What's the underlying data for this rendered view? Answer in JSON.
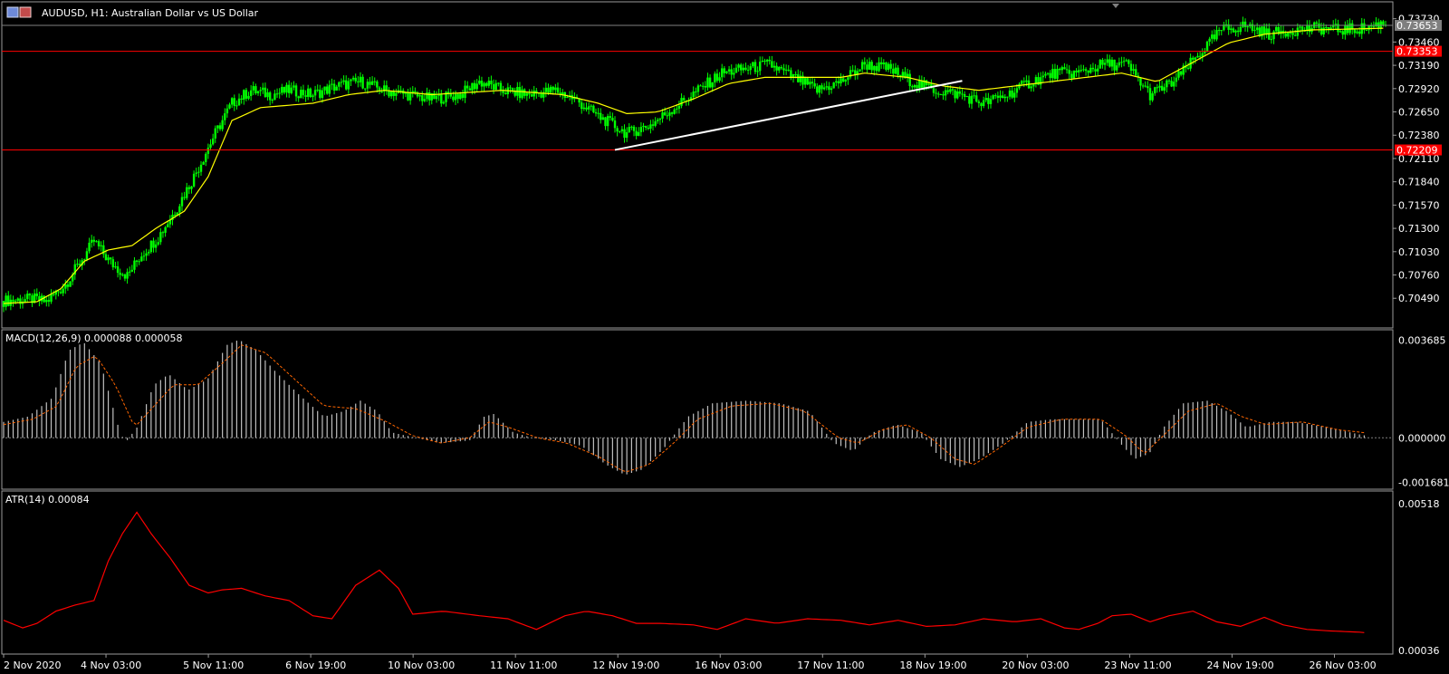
{
  "window": {
    "title": "AUDUSD, H1:  Australian Dollar vs US Dollar",
    "icon": "chart-window-icon"
  },
  "colors": {
    "background": "#000000",
    "candle": "#00ff00",
    "moving_average": "#ffff00",
    "hline": "#ff0000",
    "trendline": "#ffffff",
    "macd_hist": "#c0c0c0",
    "macd_signal": "#ff6600",
    "atr_line": "#ff0000",
    "pane_border": "#ffffff",
    "tag_bg": "#ff0000"
  },
  "chart_data": [
    {
      "type": "candlestick",
      "title": "AUDUSD, H1:  Australian Dollar vs US Dollar",
      "x_labels": [
        "2 Nov 2020",
        "4 Nov 03:00",
        "5 Nov 11:00",
        "6 Nov 19:00",
        "10 Nov 03:00",
        "11 Nov 11:00",
        "12 Nov 19:00",
        "16 Nov 03:00",
        "17 Nov 11:00",
        "18 Nov 19:00",
        "20 Nov 03:00",
        "23 Nov 11:00",
        "24 Nov 19:00",
        "26 Nov 03:00"
      ],
      "y_ticks": [
        "0.73730",
        "0.73460",
        "0.73190",
        "0.72920",
        "0.72650",
        "0.72380",
        "0.72110",
        "0.71840",
        "0.71570",
        "0.71300",
        "0.71030",
        "0.70760",
        "0.70490"
      ],
      "ylim": [
        0.7023,
        0.738
      ],
      "close_path": [
        [
          0,
          0.7046
        ],
        [
          12,
          0.7048
        ],
        [
          18,
          0.7045
        ],
        [
          26,
          0.7065
        ],
        [
          32,
          0.709
        ],
        [
          38,
          0.7115
        ],
        [
          45,
          0.709
        ],
        [
          52,
          0.7075
        ],
        [
          58,
          0.71
        ],
        [
          65,
          0.712
        ],
        [
          72,
          0.715
        ],
        [
          80,
          0.719
        ],
        [
          88,
          0.7235
        ],
        [
          96,
          0.7275
        ],
        [
          104,
          0.729
        ],
        [
          112,
          0.7285
        ],
        [
          120,
          0.729
        ],
        [
          130,
          0.7285
        ],
        [
          140,
          0.7295
        ],
        [
          150,
          0.73
        ],
        [
          160,
          0.729
        ],
        [
          170,
          0.7285
        ],
        [
          180,
          0.728
        ],
        [
          192,
          0.7285
        ],
        [
          200,
          0.73
        ],
        [
          210,
          0.729
        ],
        [
          220,
          0.7285
        ],
        [
          232,
          0.729
        ],
        [
          240,
          0.728
        ],
        [
          250,
          0.726
        ],
        [
          262,
          0.724
        ],
        [
          272,
          0.725
        ],
        [
          282,
          0.727
        ],
        [
          292,
          0.729
        ],
        [
          302,
          0.731
        ],
        [
          312,
          0.7315
        ],
        [
          322,
          0.732
        ],
        [
          332,
          0.7305
        ],
        [
          342,
          0.729
        ],
        [
          352,
          0.73
        ],
        [
          362,
          0.732
        ],
        [
          372,
          0.7315
        ],
        [
          382,
          0.73
        ],
        [
          392,
          0.729
        ],
        [
          402,
          0.7285
        ],
        [
          412,
          0.7275
        ],
        [
          422,
          0.7285
        ],
        [
          432,
          0.73
        ],
        [
          442,
          0.731
        ],
        [
          452,
          0.731
        ],
        [
          462,
          0.732
        ],
        [
          472,
          0.732
        ],
        [
          482,
          0.7285
        ],
        [
          492,
          0.73
        ],
        [
          502,
          0.733
        ],
        [
          512,
          0.736
        ],
        [
          522,
          0.7365
        ],
        [
          532,
          0.7355
        ],
        [
          542,
          0.736
        ],
        [
          552,
          0.7362
        ],
        [
          562,
          0.736
        ],
        [
          572,
          0.7362
        ],
        [
          580,
          0.7368
        ]
      ],
      "moving_average_path": [
        [
          0,
          0.7043
        ],
        [
          14,
          0.7045
        ],
        [
          24,
          0.706
        ],
        [
          34,
          0.7092
        ],
        [
          44,
          0.7105
        ],
        [
          54,
          0.711
        ],
        [
          64,
          0.713
        ],
        [
          76,
          0.715
        ],
        [
          86,
          0.719
        ],
        [
          96,
          0.7255
        ],
        [
          108,
          0.727
        ],
        [
          130,
          0.7275
        ],
        [
          145,
          0.7285
        ],
        [
          160,
          0.729
        ],
        [
          180,
          0.7285
        ],
        [
          210,
          0.729
        ],
        [
          235,
          0.7285
        ],
        [
          250,
          0.7275
        ],
        [
          262,
          0.7263
        ],
        [
          275,
          0.7265
        ],
        [
          290,
          0.728
        ],
        [
          305,
          0.7298
        ],
        [
          320,
          0.7305
        ],
        [
          340,
          0.7305
        ],
        [
          352,
          0.7305
        ],
        [
          362,
          0.731
        ],
        [
          380,
          0.7305
        ],
        [
          395,
          0.7295
        ],
        [
          410,
          0.729
        ],
        [
          425,
          0.7295
        ],
        [
          440,
          0.73
        ],
        [
          455,
          0.7305
        ],
        [
          470,
          0.731
        ],
        [
          485,
          0.73
        ],
        [
          495,
          0.7315
        ],
        [
          505,
          0.733
        ],
        [
          515,
          0.7345
        ],
        [
          530,
          0.7355
        ],
        [
          550,
          0.736
        ],
        [
          580,
          0.7362
        ]
      ],
      "candle_wick": 0.0012,
      "horizontal_lines": [
        {
          "value": 0.73353,
          "label": "0.73353"
        },
        {
          "value": 0.72209,
          "label": "0.72209"
        }
      ],
      "current_price": {
        "value": 0.73653,
        "label": "0.73653"
      },
      "trendline": {
        "from": [
          257,
          0.7221
        ],
        "to": [
          403,
          0.7301
        ]
      },
      "grid": false
    },
    {
      "type": "histogram+line",
      "title": "MACD(12,26,9) 0.000088 0.000058",
      "y_ticks": [
        "0.003685",
        "0.000000",
        "-0.001681"
      ],
      "ylim": [
        -0.0018,
        0.0038
      ],
      "hist_path": [
        [
          0,
          0.0006
        ],
        [
          10,
          0.0008
        ],
        [
          20,
          0.0015
        ],
        [
          27,
          0.0033
        ],
        [
          33,
          0.0036
        ],
        [
          40,
          0.0028
        ],
        [
          47,
          0.0005
        ],
        [
          50,
          -0.0002
        ],
        [
          55,
          0.0004
        ],
        [
          62,
          0.002
        ],
        [
          68,
          0.0024
        ],
        [
          76,
          0.0018
        ],
        [
          84,
          0.0022
        ],
        [
          92,
          0.0035
        ],
        [
          97,
          0.0037
        ],
        [
          104,
          0.0033
        ],
        [
          112,
          0.0025
        ],
        [
          122,
          0.0016
        ],
        [
          132,
          0.0008
        ],
        [
          140,
          0.001
        ],
        [
          147,
          0.0014
        ],
        [
          154,
          0.001
        ],
        [
          160,
          0.0002
        ],
        [
          170,
          0.0
        ],
        [
          180,
          -0.0002
        ],
        [
          192,
          -0.0001
        ],
        [
          198,
          0.0008
        ],
        [
          202,
          0.0009
        ],
        [
          210,
          0.0002
        ],
        [
          218,
          0.0
        ],
        [
          228,
          -0.0001
        ],
        [
          238,
          -0.0003
        ],
        [
          248,
          -0.001
        ],
        [
          256,
          -0.0014
        ],
        [
          263,
          -0.0012
        ],
        [
          272,
          -0.0004
        ],
        [
          282,
          0.0008
        ],
        [
          292,
          0.0013
        ],
        [
          306,
          0.0014
        ],
        [
          320,
          0.0013
        ],
        [
          332,
          0.001
        ],
        [
          342,
          -0.0002
        ],
        [
          350,
          -0.0005
        ],
        [
          358,
          0.0002
        ],
        [
          368,
          0.0005
        ],
        [
          378,
          0.0002
        ],
        [
          386,
          -0.0008
        ],
        [
          394,
          -0.0011
        ],
        [
          402,
          -0.0008
        ],
        [
          412,
          -0.0002
        ],
        [
          422,
          0.0006
        ],
        [
          432,
          0.0007
        ],
        [
          442,
          0.0007
        ],
        [
          452,
          0.0007
        ],
        [
          460,
          -0.0002
        ],
        [
          466,
          -0.0008
        ],
        [
          472,
          -0.0006
        ],
        [
          478,
          0.0004
        ],
        [
          486,
          0.0013
        ],
        [
          496,
          0.0014
        ],
        [
          504,
          0.001
        ],
        [
          512,
          0.0004
        ],
        [
          522,
          0.0006
        ],
        [
          532,
          0.0006
        ],
        [
          545,
          0.0004
        ],
        [
          560,
          0.0001
        ],
        [
          570,
          0.0
        ]
      ],
      "signal_path": [
        [
          0,
          0.0005
        ],
        [
          12,
          0.0007
        ],
        [
          22,
          0.0012
        ],
        [
          30,
          0.0027
        ],
        [
          38,
          0.0031
        ],
        [
          46,
          0.002
        ],
        [
          54,
          0.0004
        ],
        [
          62,
          0.0012
        ],
        [
          70,
          0.002
        ],
        [
          80,
          0.002
        ],
        [
          90,
          0.0028
        ],
        [
          98,
          0.0035
        ],
        [
          108,
          0.0032
        ],
        [
          120,
          0.0022
        ],
        [
          132,
          0.0012
        ],
        [
          145,
          0.0011
        ],
        [
          158,
          0.0006
        ],
        [
          168,
          0.0001
        ],
        [
          180,
          -0.0002
        ],
        [
          192,
          0.0
        ],
        [
          200,
          0.0006
        ],
        [
          208,
          0.0004
        ],
        [
          220,
          0.0
        ],
        [
          232,
          -0.0002
        ],
        [
          245,
          -0.0007
        ],
        [
          256,
          -0.0013
        ],
        [
          266,
          -0.001
        ],
        [
          276,
          -0.0002
        ],
        [
          286,
          0.0007
        ],
        [
          300,
          0.0012
        ],
        [
          316,
          0.0013
        ],
        [
          330,
          0.001
        ],
        [
          344,
          0.0
        ],
        [
          352,
          -0.0002
        ],
        [
          362,
          0.0003
        ],
        [
          372,
          0.0005
        ],
        [
          382,
          0.0
        ],
        [
          392,
          -0.0008
        ],
        [
          400,
          -0.001
        ],
        [
          410,
          -0.0004
        ],
        [
          422,
          0.0004
        ],
        [
          436,
          0.0007
        ],
        [
          452,
          0.0007
        ],
        [
          462,
          0.0001
        ],
        [
          470,
          -0.0006
        ],
        [
          478,
          0.0001
        ],
        [
          488,
          0.001
        ],
        [
          500,
          0.0013
        ],
        [
          510,
          0.0008
        ],
        [
          520,
          0.0005
        ],
        [
          535,
          0.0006
        ],
        [
          550,
          0.0003
        ],
        [
          570,
          0.0001
        ]
      ],
      "zero_line": true
    },
    {
      "type": "line",
      "title": "ATR(14) 0.00084",
      "y_ticks": [
        "0.00518",
        "0.00036"
      ],
      "ylim": [
        0.00036,
        0.00518
      ],
      "path": [
        [
          0,
          0.00135
        ],
        [
          8,
          0.0011
        ],
        [
          14,
          0.00125
        ],
        [
          22,
          0.00165
        ],
        [
          30,
          0.00185
        ],
        [
          38,
          0.002
        ],
        [
          44,
          0.0033
        ],
        [
          50,
          0.0042
        ],
        [
          56,
          0.0049
        ],
        [
          62,
          0.0042
        ],
        [
          70,
          0.0034
        ],
        [
          78,
          0.0025
        ],
        [
          86,
          0.00225
        ],
        [
          92,
          0.00235
        ],
        [
          100,
          0.0024
        ],
        [
          110,
          0.00215
        ],
        [
          120,
          0.002
        ],
        [
          130,
          0.0015
        ],
        [
          138,
          0.0014
        ],
        [
          148,
          0.0025
        ],
        [
          158,
          0.003
        ],
        [
          166,
          0.0024
        ],
        [
          172,
          0.00155
        ],
        [
          185,
          0.00165
        ],
        [
          200,
          0.0015
        ],
        [
          212,
          0.0014
        ],
        [
          224,
          0.00105
        ],
        [
          236,
          0.0015
        ],
        [
          245,
          0.00165
        ],
        [
          256,
          0.0015
        ],
        [
          266,
          0.00125
        ],
        [
          276,
          0.00125
        ],
        [
          290,
          0.0012
        ],
        [
          300,
          0.00105
        ],
        [
          312,
          0.0014
        ],
        [
          325,
          0.00125
        ],
        [
          338,
          0.0014
        ],
        [
          352,
          0.00135
        ],
        [
          364,
          0.0012
        ],
        [
          376,
          0.00135
        ],
        [
          388,
          0.00115
        ],
        [
          400,
          0.0012
        ],
        [
          412,
          0.0014
        ],
        [
          425,
          0.0013
        ],
        [
          436,
          0.0014
        ],
        [
          446,
          0.0011
        ],
        [
          452,
          0.00105
        ],
        [
          460,
          0.00125
        ],
        [
          466,
          0.0015
        ],
        [
          474,
          0.00155
        ],
        [
          482,
          0.0013
        ],
        [
          490,
          0.0015
        ],
        [
          500,
          0.00165
        ],
        [
          510,
          0.0013
        ],
        [
          520,
          0.00115
        ],
        [
          530,
          0.00145
        ],
        [
          538,
          0.0012
        ],
        [
          548,
          0.00105
        ],
        [
          558,
          0.001
        ],
        [
          570,
          0.00096
        ],
        [
          576,
          0.00092
        ]
      ],
      "grid": false
    }
  ]
}
